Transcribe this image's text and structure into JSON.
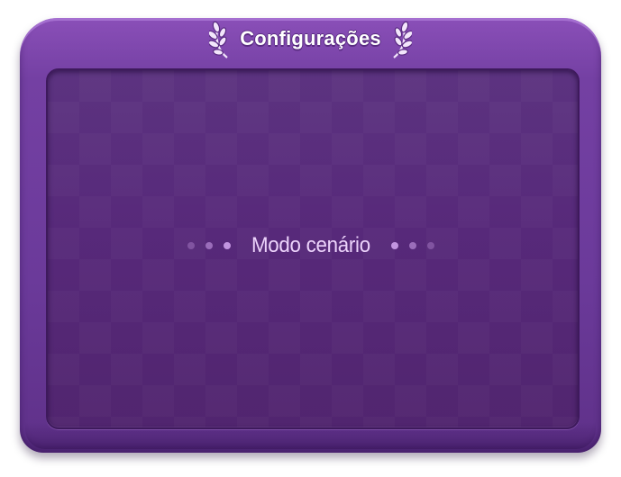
{
  "dialog": {
    "title": "Configurações",
    "mode_label": "Modo cenário"
  },
  "icons": {
    "left_ornament": "laurel-branch-icon",
    "right_ornament": "laurel-branch-icon",
    "decor_dots": "dot-separator-icon"
  },
  "colors": {
    "frame": "#6b3a9a",
    "panel": "#57297a",
    "title_text": "#ffffff",
    "label_text": "#ecd3fb",
    "dot": "#c89be6"
  }
}
